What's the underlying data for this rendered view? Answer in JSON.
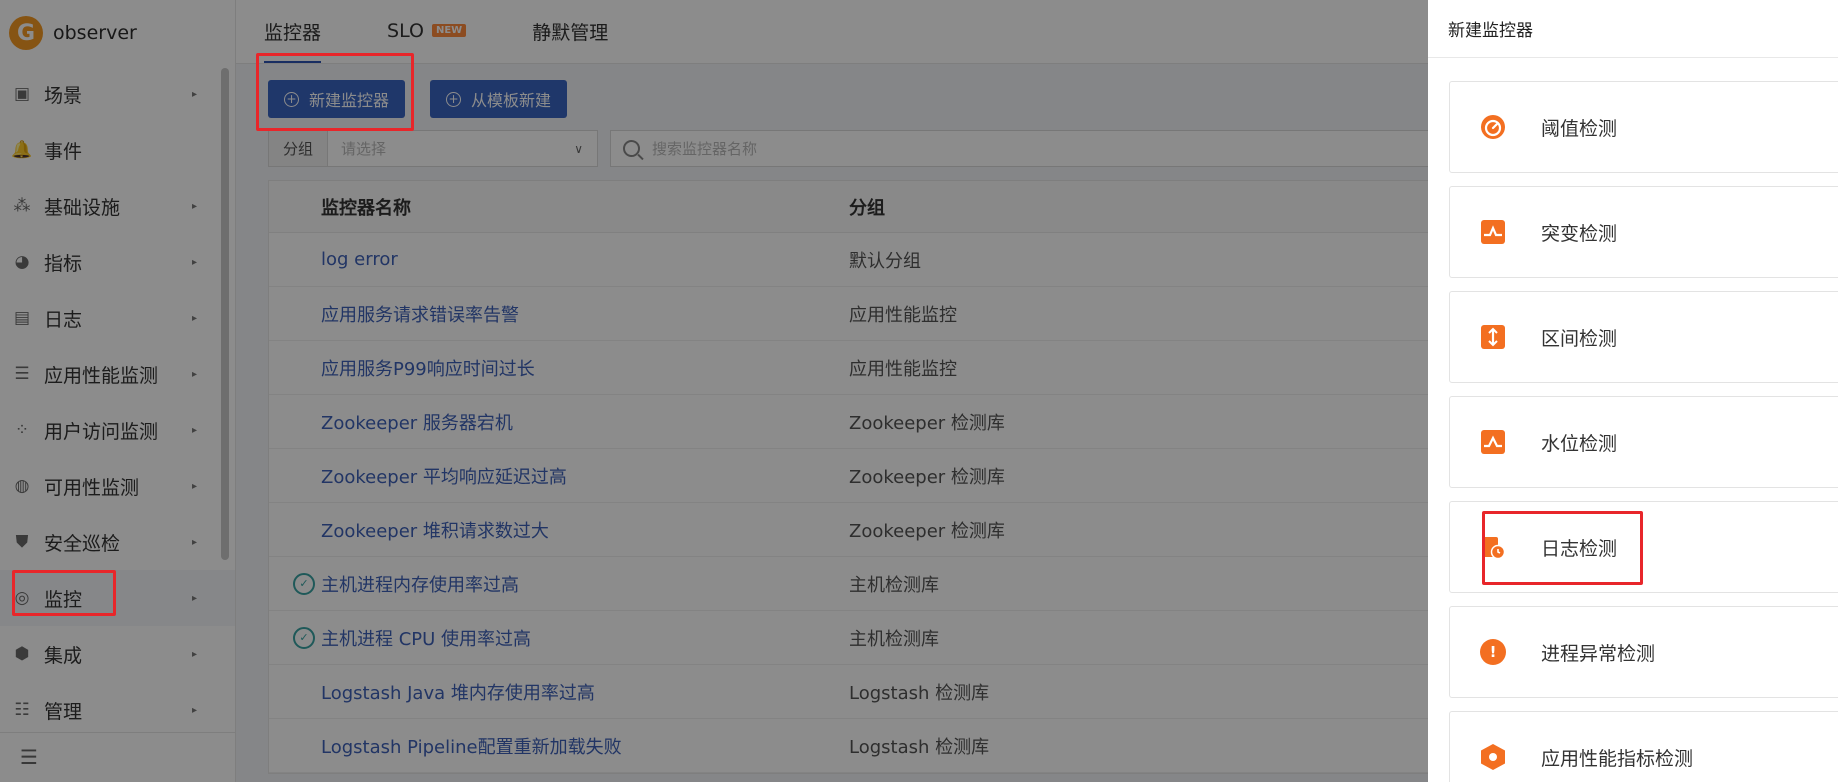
{
  "app": {
    "name": "observer",
    "logo_letter": "G"
  },
  "sidebar": {
    "items": [
      {
        "label": "场景",
        "icon": "dashboard-icon",
        "glyph": "▣"
      },
      {
        "label": "事件",
        "icon": "bell-icon",
        "glyph": "🔔"
      },
      {
        "label": "基础设施",
        "icon": "infrastructure-icon",
        "glyph": "⁂"
      },
      {
        "label": "指标",
        "icon": "metrics-icon",
        "glyph": "◕"
      },
      {
        "label": "日志",
        "icon": "calendar-log-icon",
        "glyph": "▤"
      },
      {
        "label": "应用性能监测",
        "icon": "apm-filter-icon",
        "glyph": "☰"
      },
      {
        "label": "用户访问监测",
        "icon": "rum-icon",
        "glyph": "⁘"
      },
      {
        "label": "可用性监测",
        "icon": "availability-icon",
        "glyph": "◍"
      },
      {
        "label": "安全巡检",
        "icon": "shield-icon",
        "glyph": "⛊"
      },
      {
        "label": "监控",
        "icon": "monitor-radar-icon",
        "glyph": "◎"
      },
      {
        "label": "集成",
        "icon": "integration-cube-icon",
        "glyph": "⬢"
      },
      {
        "label": "管理",
        "icon": "settings-sliders-icon",
        "glyph": "☷"
      }
    ],
    "collapse_glyph": "☰"
  },
  "tabs": [
    {
      "label": "监控器"
    },
    {
      "label": "SLO",
      "badge": "NEW"
    },
    {
      "label": "静默管理"
    }
  ],
  "toolbar": {
    "new_monitor": "新建监控器",
    "from_template": "从模板新建"
  },
  "filter": {
    "group_label": "分组",
    "group_placeholder": "请选择",
    "search_placeholder": "搜索监控器名称"
  },
  "table": {
    "headers": {
      "name": "监控器名称",
      "group": "分组"
    },
    "rows": [
      {
        "name": "log error",
        "group": "默认分组",
        "has_icon": false
      },
      {
        "name": "应用服务请求错误率告警",
        "group": "应用性能监控",
        "has_icon": false
      },
      {
        "name": "应用服务P99响应时间过长",
        "group": "应用性能监控",
        "has_icon": false
      },
      {
        "name": "Zookeeper 服务器宕机",
        "group": "Zookeeper 检测库",
        "has_icon": false
      },
      {
        "name": "Zookeeper 平均响应延迟过高",
        "group": "Zookeeper 检测库",
        "has_icon": false
      },
      {
        "name": "Zookeeper 堆积请求数过大",
        "group": "Zookeeper 检测库",
        "has_icon": false
      },
      {
        "name": "主机进程内存使用率过高",
        "group": "主机检测库",
        "has_icon": true
      },
      {
        "name": "主机进程 CPU 使用率过高",
        "group": "主机检测库",
        "has_icon": true
      },
      {
        "name": "Logstash Java 堆内存使用率过高",
        "group": "Logstash 检测库",
        "has_icon": false
      },
      {
        "name": "Logstash Pipeline配置重新加载失败",
        "group": "Logstash 检测库",
        "has_icon": false
      }
    ]
  },
  "drawer": {
    "title": "新建监控器",
    "options": [
      {
        "label": "阈值检测",
        "icon": "gauge-icon"
      },
      {
        "label": "突变检测",
        "icon": "mutation-wave-icon"
      },
      {
        "label": "区间检测",
        "icon": "range-arrows-icon"
      },
      {
        "label": "水位检测",
        "icon": "water-level-icon"
      },
      {
        "label": "日志检测",
        "icon": "log-detect-icon"
      },
      {
        "label": "进程异常检测",
        "icon": "alert-circle-icon"
      },
      {
        "label": "应用性能指标检测",
        "icon": "apm-hexagon-icon"
      }
    ]
  },
  "colors": {
    "primary": "#3a64c2",
    "accent_orange": "#f36f21",
    "highlight_red": "#e8262a",
    "link": "#3e62b8"
  }
}
